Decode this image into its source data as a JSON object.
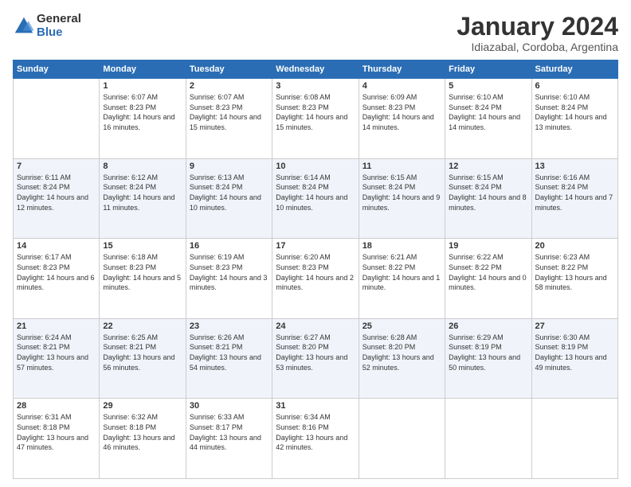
{
  "logo": {
    "general": "General",
    "blue": "Blue"
  },
  "title": "January 2024",
  "location": "Idiazabal, Cordoba, Argentina",
  "weekdays": [
    "Sunday",
    "Monday",
    "Tuesday",
    "Wednesday",
    "Thursday",
    "Friday",
    "Saturday"
  ],
  "weeks": [
    [
      null,
      {
        "day": "1",
        "sunrise": "6:07 AM",
        "sunset": "8:23 PM",
        "daylight": "14 hours and 16 minutes."
      },
      {
        "day": "2",
        "sunrise": "6:07 AM",
        "sunset": "8:23 PM",
        "daylight": "14 hours and 15 minutes."
      },
      {
        "day": "3",
        "sunrise": "6:08 AM",
        "sunset": "8:23 PM",
        "daylight": "14 hours and 15 minutes."
      },
      {
        "day": "4",
        "sunrise": "6:09 AM",
        "sunset": "8:23 PM",
        "daylight": "14 hours and 14 minutes."
      },
      {
        "day": "5",
        "sunrise": "6:10 AM",
        "sunset": "8:24 PM",
        "daylight": "14 hours and 14 minutes."
      },
      {
        "day": "6",
        "sunrise": "6:10 AM",
        "sunset": "8:24 PM",
        "daylight": "14 hours and 13 minutes."
      }
    ],
    [
      {
        "day": "7",
        "sunrise": "6:11 AM",
        "sunset": "8:24 PM",
        "daylight": "14 hours and 12 minutes."
      },
      {
        "day": "8",
        "sunrise": "6:12 AM",
        "sunset": "8:24 PM",
        "daylight": "14 hours and 11 minutes."
      },
      {
        "day": "9",
        "sunrise": "6:13 AM",
        "sunset": "8:24 PM",
        "daylight": "14 hours and 10 minutes."
      },
      {
        "day": "10",
        "sunrise": "6:14 AM",
        "sunset": "8:24 PM",
        "daylight": "14 hours and 10 minutes."
      },
      {
        "day": "11",
        "sunrise": "6:15 AM",
        "sunset": "8:24 PM",
        "daylight": "14 hours and 9 minutes."
      },
      {
        "day": "12",
        "sunrise": "6:15 AM",
        "sunset": "8:24 PM",
        "daylight": "14 hours and 8 minutes."
      },
      {
        "day": "13",
        "sunrise": "6:16 AM",
        "sunset": "8:24 PM",
        "daylight": "14 hours and 7 minutes."
      }
    ],
    [
      {
        "day": "14",
        "sunrise": "6:17 AM",
        "sunset": "8:23 PM",
        "daylight": "14 hours and 6 minutes."
      },
      {
        "day": "15",
        "sunrise": "6:18 AM",
        "sunset": "8:23 PM",
        "daylight": "14 hours and 5 minutes."
      },
      {
        "day": "16",
        "sunrise": "6:19 AM",
        "sunset": "8:23 PM",
        "daylight": "14 hours and 3 minutes."
      },
      {
        "day": "17",
        "sunrise": "6:20 AM",
        "sunset": "8:23 PM",
        "daylight": "14 hours and 2 minutes."
      },
      {
        "day": "18",
        "sunrise": "6:21 AM",
        "sunset": "8:22 PM",
        "daylight": "14 hours and 1 minute."
      },
      {
        "day": "19",
        "sunrise": "6:22 AM",
        "sunset": "8:22 PM",
        "daylight": "14 hours and 0 minutes."
      },
      {
        "day": "20",
        "sunrise": "6:23 AM",
        "sunset": "8:22 PM",
        "daylight": "13 hours and 58 minutes."
      }
    ],
    [
      {
        "day": "21",
        "sunrise": "6:24 AM",
        "sunset": "8:21 PM",
        "daylight": "13 hours and 57 minutes."
      },
      {
        "day": "22",
        "sunrise": "6:25 AM",
        "sunset": "8:21 PM",
        "daylight": "13 hours and 56 minutes."
      },
      {
        "day": "23",
        "sunrise": "6:26 AM",
        "sunset": "8:21 PM",
        "daylight": "13 hours and 54 minutes."
      },
      {
        "day": "24",
        "sunrise": "6:27 AM",
        "sunset": "8:20 PM",
        "daylight": "13 hours and 53 minutes."
      },
      {
        "day": "25",
        "sunrise": "6:28 AM",
        "sunset": "8:20 PM",
        "daylight": "13 hours and 52 minutes."
      },
      {
        "day": "26",
        "sunrise": "6:29 AM",
        "sunset": "8:19 PM",
        "daylight": "13 hours and 50 minutes."
      },
      {
        "day": "27",
        "sunrise": "6:30 AM",
        "sunset": "8:19 PM",
        "daylight": "13 hours and 49 minutes."
      }
    ],
    [
      {
        "day": "28",
        "sunrise": "6:31 AM",
        "sunset": "8:18 PM",
        "daylight": "13 hours and 47 minutes."
      },
      {
        "day": "29",
        "sunrise": "6:32 AM",
        "sunset": "8:18 PM",
        "daylight": "13 hours and 46 minutes."
      },
      {
        "day": "30",
        "sunrise": "6:33 AM",
        "sunset": "8:17 PM",
        "daylight": "13 hours and 44 minutes."
      },
      {
        "day": "31",
        "sunrise": "6:34 AM",
        "sunset": "8:16 PM",
        "daylight": "13 hours and 42 minutes."
      },
      null,
      null,
      null
    ]
  ]
}
